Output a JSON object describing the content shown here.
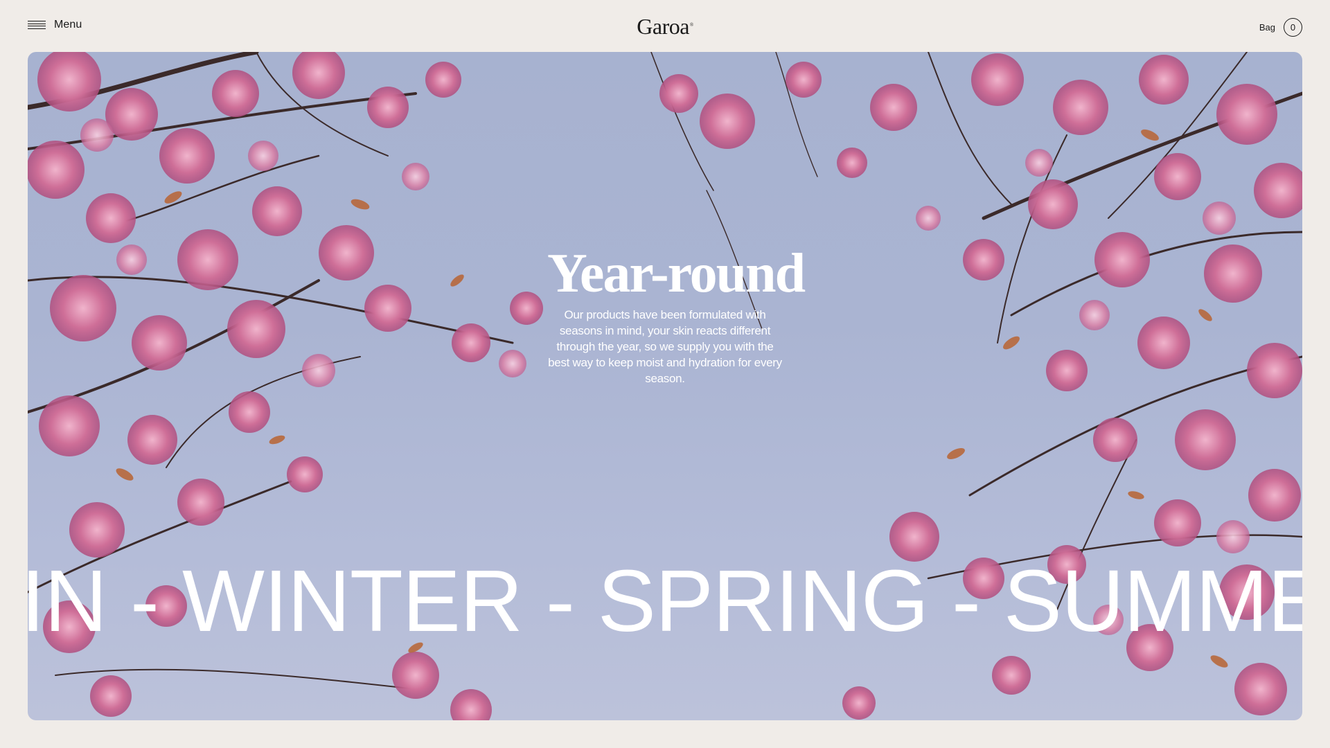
{
  "header": {
    "menu_label": "Menu",
    "logo": "Garoa",
    "logo_mark": "®",
    "bag_label": "Bag",
    "bag_count": "0"
  },
  "hero": {
    "title": "Year-round",
    "description": "Our products have been formulated with seasons in mind, your skin reacts different through the year, so we supply you with the best way to keep moist and hydration for every season.",
    "marquee_text": "IN - WINTER - SPRING - SUMMER",
    "sky_color": "#a9b3d1",
    "blossom_color": "#c9648f",
    "leaf_color": "#b86a3a"
  }
}
